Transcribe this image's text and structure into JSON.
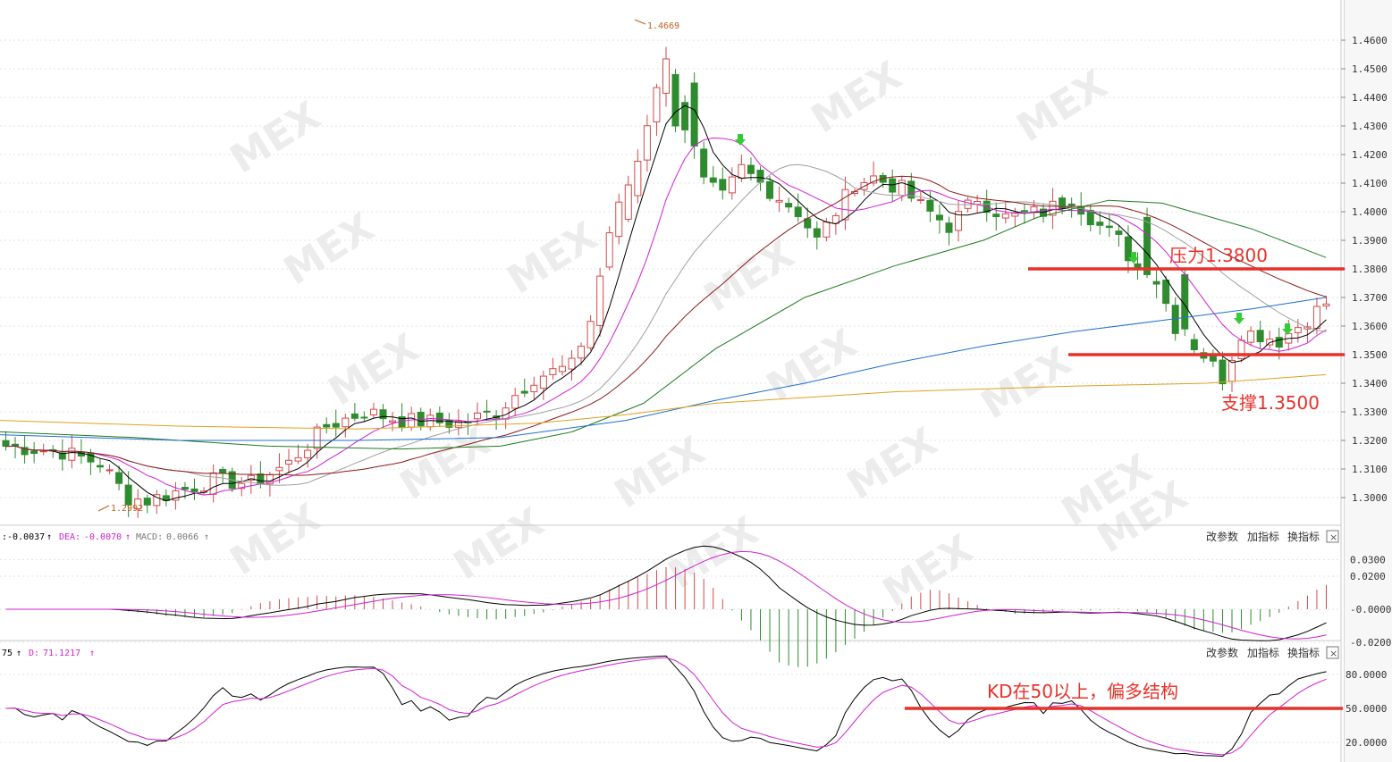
{
  "chart_data": [
    {
      "type": "candlestick",
      "panel": "price",
      "yaxis": {
        "min": 1.29,
        "max": 1.47,
        "ticks": [
          "1.4600",
          "1.4500",
          "1.4400",
          "1.4300",
          "1.4200",
          "1.4100",
          "1.4000",
          "1.3900",
          "1.3800",
          "1.3700",
          "1.3600",
          "1.3500",
          "1.3400",
          "1.3300",
          "1.3200",
          "1.3100",
          "1.3000"
        ]
      },
      "grid": "horizontal dotted",
      "markers": {
        "high": "1.4669",
        "low": "1.2992"
      },
      "annotations": [
        {
          "text": "压力1.3800",
          "level": 1.38,
          "color": "#e8312a"
        },
        {
          "text": "支撑1.3500",
          "level": 1.35,
          "color": "#e8312a"
        }
      ],
      "colors": {
        "up": "#d24a4a",
        "down": "#2e8b2e",
        "ma5": "#000000",
        "ma10": "#d020d0",
        "ma20": "#a0a0a0",
        "ma30": "#8b1a1a",
        "ma60": "#1e7b1e",
        "ma120": "#1f6fd0",
        "ma250": "#e0a020"
      }
    },
    {
      "type": "line",
      "panel": "MACD",
      "header": {
        "dif": ":-0.0037",
        "dea_label": "DEA:",
        "dea": "-0.0070",
        "macd_label": "MACD:",
        "macd": "0.0066"
      },
      "yaxis": {
        "ticks": [
          "0.0300",
          "0.0200",
          "-0.0000",
          "-0.0200"
        ]
      },
      "tools": [
        "改参数",
        "加指标",
        "换指标"
      ]
    },
    {
      "type": "line",
      "panel": "KD",
      "header": {
        "k": "75",
        "d_label": "D:",
        "d": "71.1217"
      },
      "yaxis": {
        "ticks": [
          "80.0000",
          "50.0000",
          "20.0000"
        ]
      },
      "annotation": {
        "text": "KD在50以上，偏多结构",
        "level": 50,
        "color": "#e8312a"
      },
      "tools": [
        "改参数",
        "加指标",
        "换指标"
      ]
    }
  ],
  "watermark": "MEX"
}
